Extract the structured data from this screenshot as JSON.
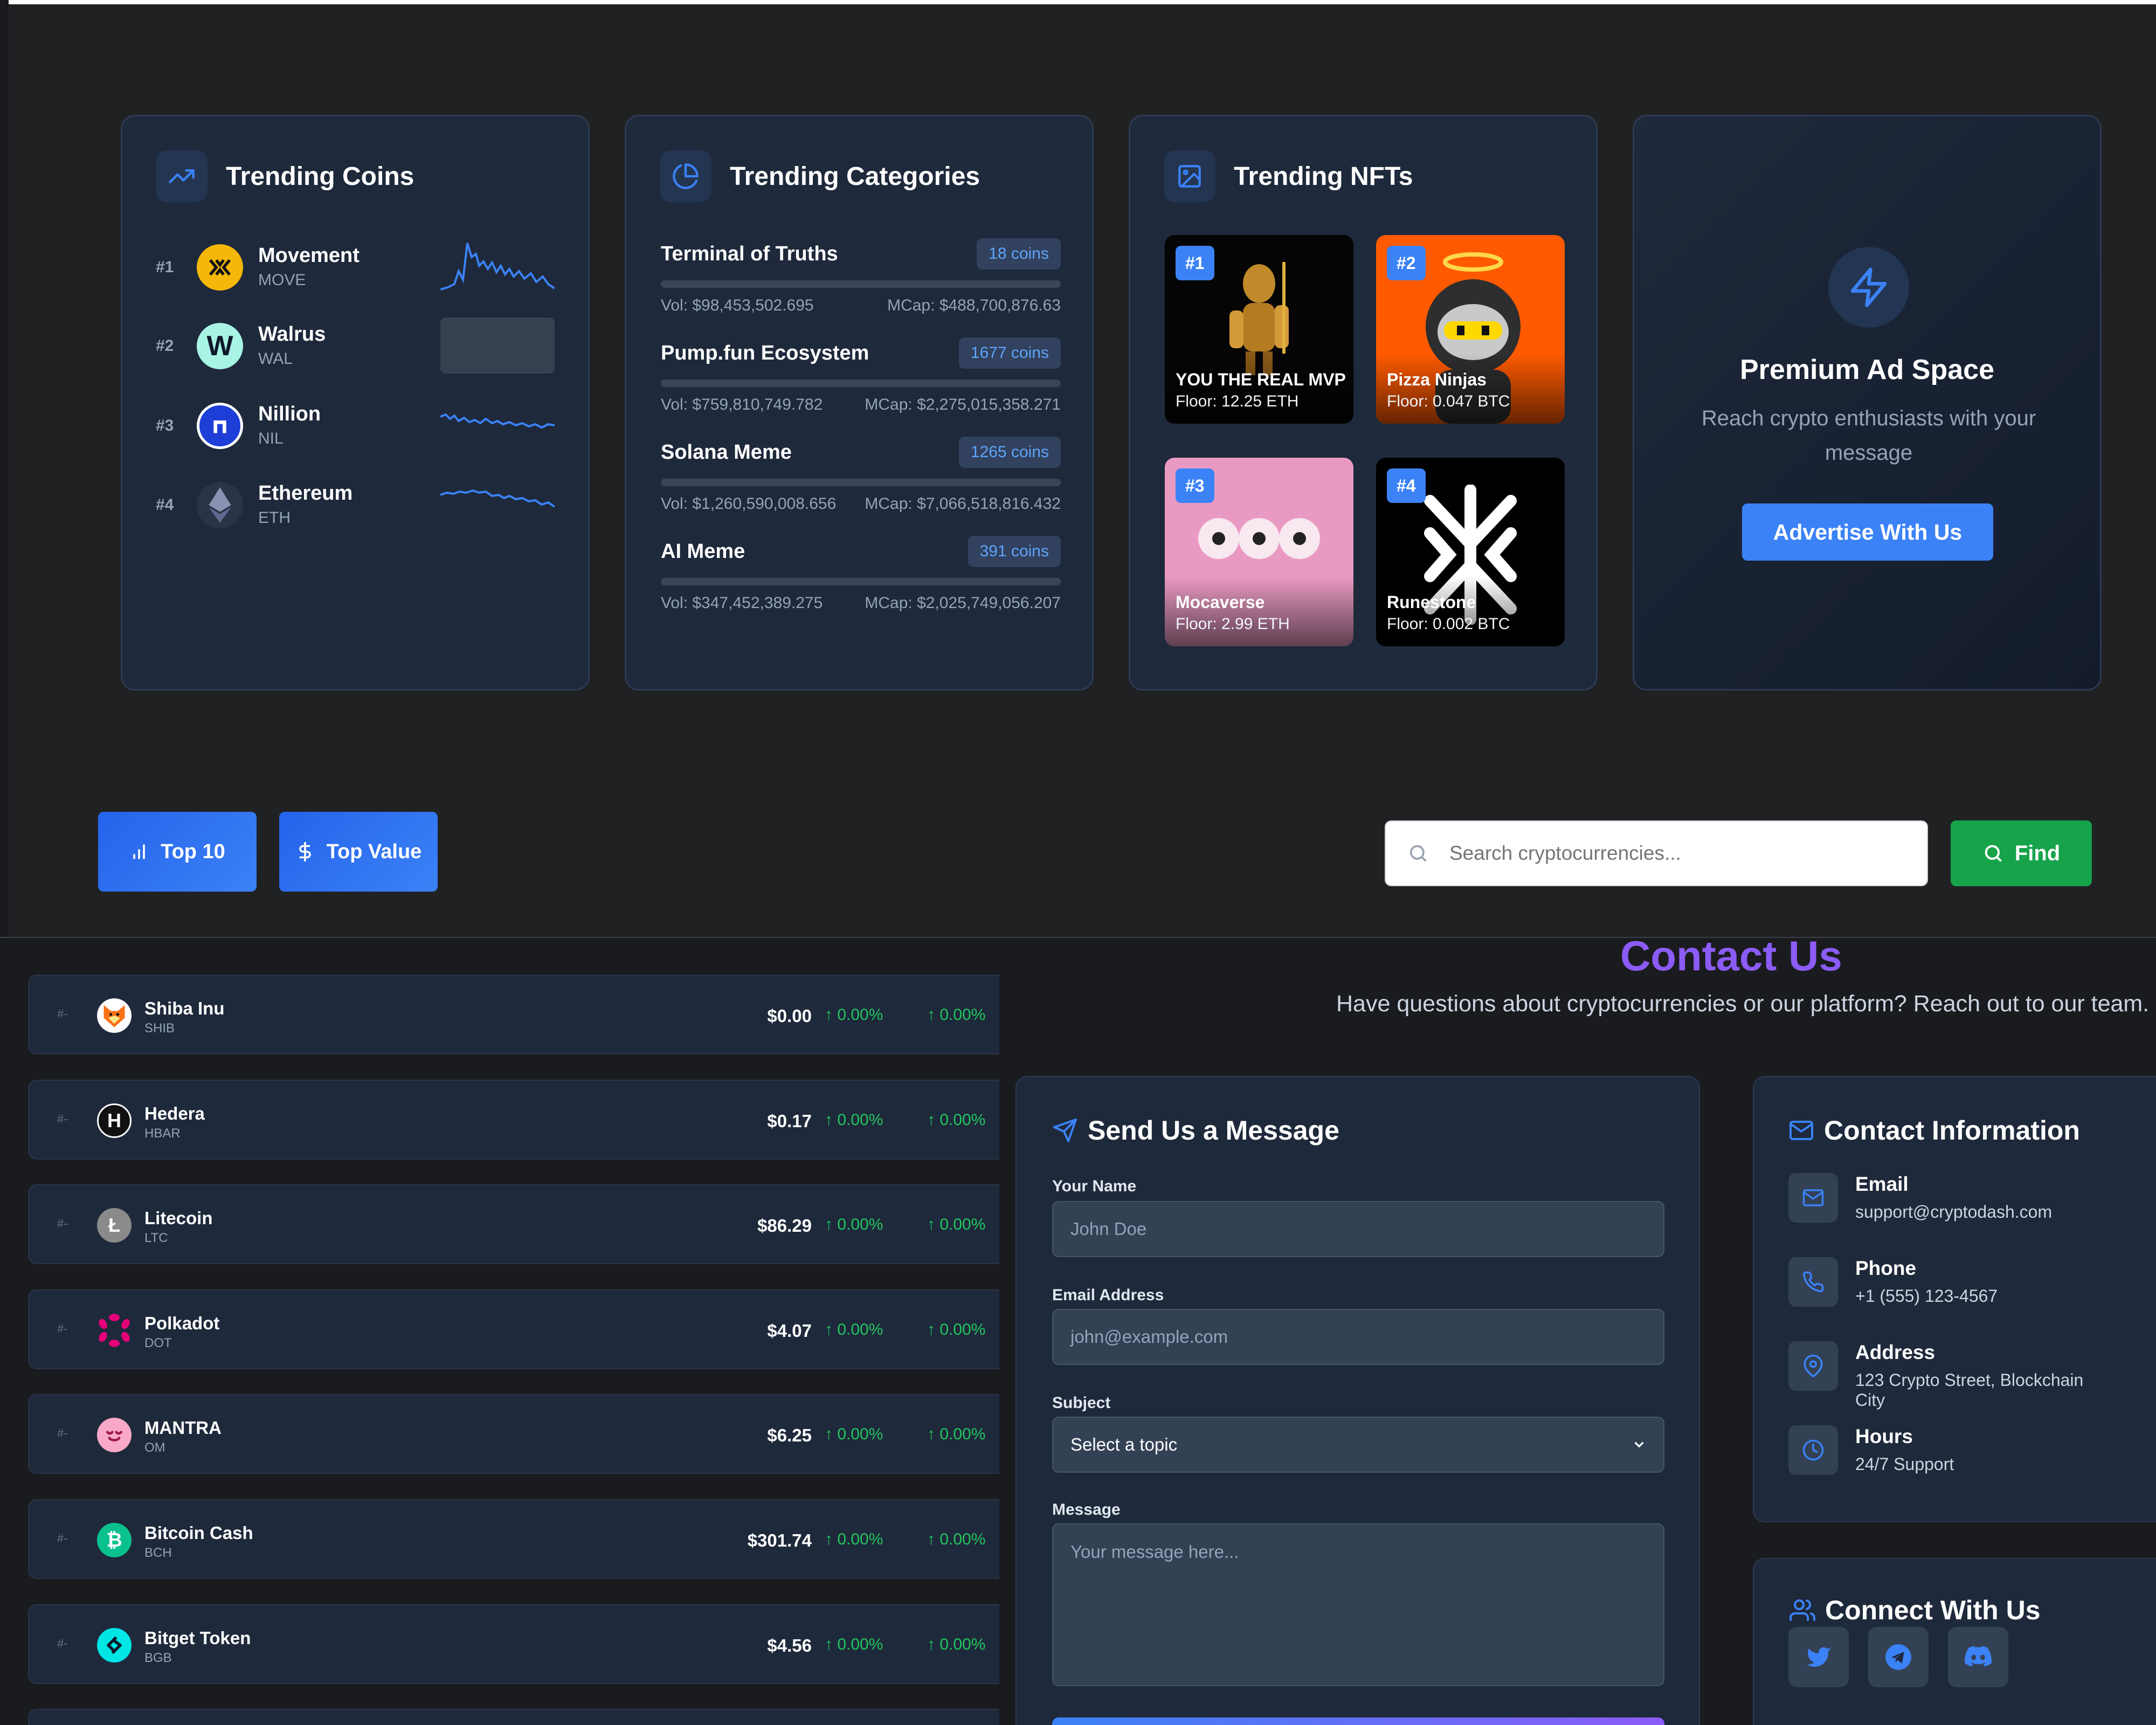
{
  "colors": {
    "accent": "#3b82f6",
    "positive": "#22c55e",
    "card": "#1e293b",
    "find": "#16a34a",
    "contact_title": "#8b5cf6"
  },
  "trending_coins": {
    "title": "Trending Coins",
    "icon": "trending-up-icon",
    "items": [
      {
        "rank": "#1",
        "name": "Movement",
        "symbol": "MOVE"
      },
      {
        "rank": "#2",
        "name": "Walrus",
        "symbol": "WAL"
      },
      {
        "rank": "#3",
        "name": "Nillion",
        "symbol": "NIL"
      },
      {
        "rank": "#4",
        "name": "Ethereum",
        "symbol": "ETH"
      }
    ]
  },
  "trending_categories": {
    "title": "Trending Categories",
    "icon": "pie-chart-icon",
    "items": [
      {
        "name": "Terminal of Truths",
        "coins": "18 coins",
        "vol": "Vol: $98,453,502.695",
        "mcap": "MCap: $488,700,876.63"
      },
      {
        "name": "Pump.fun Ecosystem",
        "coins": "1677 coins",
        "vol": "Vol: $759,810,749.782",
        "mcap": "MCap: $2,275,015,358.271"
      },
      {
        "name": "Solana Meme",
        "coins": "1265 coins",
        "vol": "Vol: $1,260,590,008.656",
        "mcap": "MCap: $7,066,518,816.432"
      },
      {
        "name": "AI Meme",
        "coins": "391 coins",
        "vol": "Vol: $347,452,389.275",
        "mcap": "MCap: $2,025,749,056.207"
      }
    ]
  },
  "trending_nfts": {
    "title": "Trending NFTs",
    "icon": "image-icon",
    "items": [
      {
        "rank": "#1",
        "name": "YOU THE REAL MVP",
        "floor": "Floor: 12.25 ETH"
      },
      {
        "rank": "#2",
        "name": "Pizza Ninjas",
        "floor": "Floor: 0.047 BTC"
      },
      {
        "rank": "#3",
        "name": "Mocaverse",
        "floor": "Floor: 2.99 ETH"
      },
      {
        "rank": "#4",
        "name": "Runestone",
        "floor": "Floor: 0.002 BTC"
      }
    ]
  },
  "ad": {
    "icon": "lightning-icon",
    "title": "Premium Ad Space",
    "text": "Reach crypto enthusiasts with your message",
    "button": "Advertise With Us"
  },
  "toolbar": {
    "top10": "Top 10",
    "top10_icon": "bar-chart-icon",
    "top_value": "Top Value",
    "top_value_icon": "dollar-icon",
    "search_placeholder": "Search cryptocurrencies...",
    "find": "Find"
  },
  "coin_rows": [
    {
      "rank": "#-",
      "name": "Shiba Inu",
      "symbol": "SHIB",
      "price": "$0.00",
      "ch1": "0.00%",
      "ch2": "0.00%"
    },
    {
      "rank": "#-",
      "name": "Hedera",
      "symbol": "HBAR",
      "price": "$0.17",
      "ch1": "0.00%",
      "ch2": "0.00%"
    },
    {
      "rank": "#-",
      "name": "Litecoin",
      "symbol": "LTC",
      "price": "$86.29",
      "ch1": "0.00%",
      "ch2": "0.00%"
    },
    {
      "rank": "#-",
      "name": "Polkadot",
      "symbol": "DOT",
      "price": "$4.07",
      "ch1": "0.00%",
      "ch2": "0.00%"
    },
    {
      "rank": "#-",
      "name": "MANTRA",
      "symbol": "OM",
      "price": "$6.25",
      "ch1": "0.00%",
      "ch2": "0.00%"
    },
    {
      "rank": "#-",
      "name": "Bitcoin Cash",
      "symbol": "BCH",
      "price": "$301.74",
      "ch1": "0.00%",
      "ch2": "0.00%"
    },
    {
      "rank": "#-",
      "name": "Bitget Token",
      "symbol": "BGB",
      "price": "$4.56",
      "ch1": "0.00%",
      "ch2": "0.00%"
    }
  ],
  "contact": {
    "title": "Contact Us",
    "subtitle": "Have questions about cryptocurrencies or our platform? Reach out to our team.",
    "form": {
      "title": "Send Us a Message",
      "name_label": "Your Name",
      "name_placeholder": "John Doe",
      "email_label": "Email Address",
      "email_placeholder": "john@example.com",
      "subject_label": "Subject",
      "subject_value": "Select a topic",
      "message_label": "Message",
      "message_placeholder": "Your message here..."
    },
    "info": {
      "title": "Contact Information",
      "items": [
        {
          "label": "Email",
          "value": "support@cryptodash.com",
          "icon": "mail-icon"
        },
        {
          "label": "Phone",
          "value": "+1 (555) 123-4567",
          "icon": "phone-icon"
        },
        {
          "label": "Address",
          "value": "123 Crypto Street, Blockchain City",
          "icon": "map-pin-icon"
        },
        {
          "label": "Hours",
          "value": "24/7 Support",
          "icon": "clock-icon"
        }
      ]
    },
    "connect": {
      "title": "Connect With Us",
      "icons": [
        "twitter-icon",
        "telegram-icon",
        "discord-icon"
      ]
    }
  }
}
